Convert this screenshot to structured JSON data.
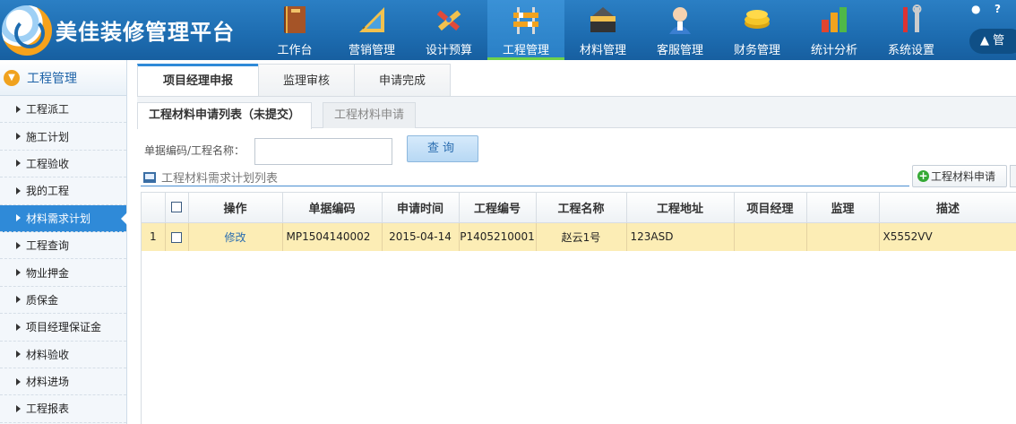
{
  "app": {
    "title": "美佳装修管理平台",
    "user_label": "管"
  },
  "nav": {
    "items": [
      {
        "label": "工作台",
        "icon": "book-icon"
      },
      {
        "label": "营销管理",
        "icon": "ruler-icon"
      },
      {
        "label": "设计预算",
        "icon": "pencil-icon"
      },
      {
        "label": "工程管理",
        "icon": "barrier-icon"
      },
      {
        "label": "材料管理",
        "icon": "toolbox-icon"
      },
      {
        "label": "客服管理",
        "icon": "agent-icon"
      },
      {
        "label": "财务管理",
        "icon": "coins-icon"
      },
      {
        "label": "统计分析",
        "icon": "bar-chart-icon"
      },
      {
        "label": "系统设置",
        "icon": "tools-icon"
      }
    ],
    "active": "工程管理"
  },
  "sidebar": {
    "header": "工程管理",
    "items": [
      {
        "label": "工程派工"
      },
      {
        "label": "施工计划"
      },
      {
        "label": "工程验收"
      },
      {
        "label": "我的工程"
      },
      {
        "label": "材料需求计划"
      },
      {
        "label": "工程查询"
      },
      {
        "label": "物业押金"
      },
      {
        "label": "质保金"
      },
      {
        "label": "项目经理保证金"
      },
      {
        "label": "材料验收"
      },
      {
        "label": "材料进场"
      },
      {
        "label": "工程报表"
      }
    ],
    "active": "材料需求计划"
  },
  "top_tabs": {
    "items": [
      "项目经理申报",
      "监理审核",
      "申请完成"
    ],
    "active": "项目经理申报"
  },
  "sub_tabs": {
    "items": [
      "工程材料申请列表（未提交）",
      "工程材料申请"
    ],
    "active": "工程材料申请列表（未提交）"
  },
  "search": {
    "label": "单据编码/工程名称：",
    "value": "",
    "button": "查询"
  },
  "list": {
    "caption": "工程材料需求计划列表",
    "add_button": "工程材料申请"
  },
  "table": {
    "columns": [
      "操作",
      "单据编码",
      "申请时间",
      "工程编号",
      "工程名称",
      "工程地址",
      "项目经理",
      "监理",
      "描述"
    ],
    "rows": [
      {
        "index": "1",
        "action": "修改",
        "doc_code": "MP1504140002",
        "apply_date": "2015-04-14",
        "project_no": "P1405210001",
        "project_name": "赵云1号",
        "address": "123ASD",
        "manager": "",
        "supervisor": "",
        "description": "X5552VV"
      }
    ]
  },
  "colors": {
    "header_blue": "#1d6cb0",
    "accent_blue": "#2f8ad8",
    "row_highlight": "#fcedb5",
    "active_underline": "#6fd14b"
  }
}
